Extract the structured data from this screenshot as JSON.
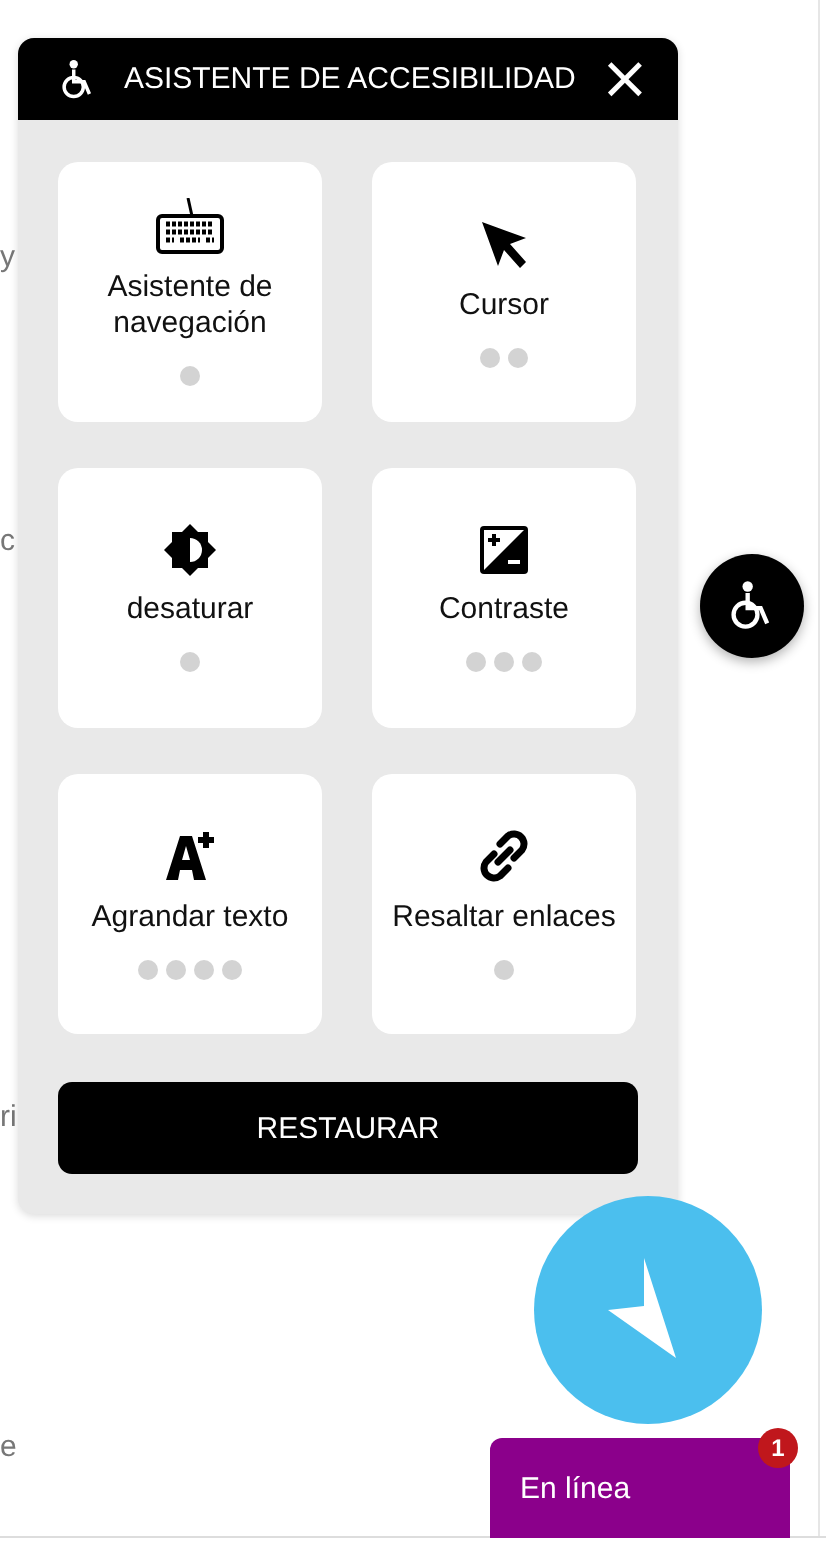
{
  "page_fragments": [
    "y",
    "c",
    "ri",
    "e"
  ],
  "panel": {
    "title": "ASISTENTE DE ACCESIBILIDAD",
    "close": "×",
    "options": [
      {
        "label": "Asistente de navegación",
        "dots": [
          {
            "active": false
          }
        ]
      },
      {
        "label": "Cursor",
        "dots": [
          {
            "active": false
          },
          {
            "active": false
          }
        ]
      },
      {
        "label": "desaturar",
        "dots": [
          {
            "active": false
          }
        ]
      },
      {
        "label": "Contraste",
        "dots": [
          {
            "active": false
          },
          {
            "active": false
          },
          {
            "active": false
          }
        ]
      },
      {
        "label": "Agrandar texto",
        "dots": [
          {
            "active": false
          },
          {
            "active": false
          },
          {
            "active": false
          },
          {
            "active": false
          }
        ]
      },
      {
        "label": "Resaltar enlaces",
        "dots": [
          {
            "active": false
          }
        ]
      }
    ],
    "reset": "RESTAURAR"
  },
  "chat": {
    "label": "En línea",
    "badge": "1"
  }
}
